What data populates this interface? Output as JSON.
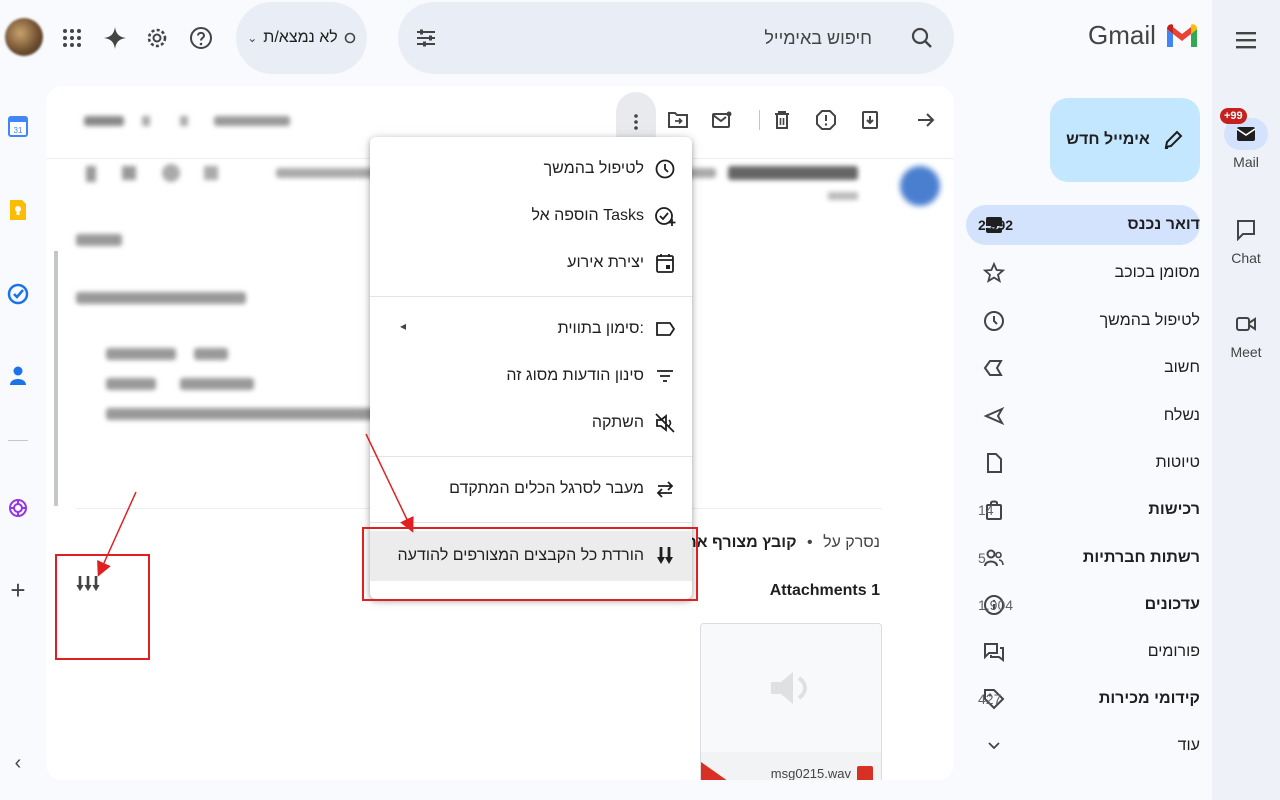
{
  "app": {
    "logo_text": "Gmail"
  },
  "header": {
    "search_placeholder": "חיפוש באימייל",
    "status_label": "לא נמצא/ת"
  },
  "compose_label": "אימייל חדש",
  "nav": [
    {
      "label": "דואר נכנס",
      "count": "2,592"
    },
    {
      "label": "מסומן בכוכב",
      "count": ""
    },
    {
      "label": "לטיפול בהמשך",
      "count": ""
    },
    {
      "label": "חשוב",
      "count": ""
    },
    {
      "label": "נשלח",
      "count": ""
    },
    {
      "label": "טיוטות",
      "count": ""
    },
    {
      "label": "רכישות",
      "count": "14"
    },
    {
      "label": "רשתות חברתיות",
      "count": "5"
    },
    {
      "label": "עדכונים",
      "count": "1,904"
    },
    {
      "label": "פורומים",
      "count": ""
    },
    {
      "label": "קידומי מכירות",
      "count": "427"
    },
    {
      "label": "עוד",
      "count": ""
    }
  ],
  "rail": {
    "mail_label": "Mail",
    "mail_badge": "+99",
    "chat_label": "Chat",
    "meet_label": "Meet"
  },
  "menu": {
    "items": [
      "לטיפול בהמשך",
      "הוספה אל Tasks",
      "יצירת אירוע",
      "סימון בתווית:",
      "סינון הודעות מסוג זה",
      "השתקה",
      "מעבר לסרגל הכלים המתקדם",
      "הורדת כל הקבצים המצורפים להודעה"
    ]
  },
  "message": {
    "attachment_summary": "קובץ מצורף אחד",
    "scan_text": "נסרק על",
    "attachments_heading": "Attachments 1",
    "attachment_file": "msg0215.wav"
  },
  "colors": {
    "accent_blue": "#1a73e8",
    "compose_bg": "#c2e7ff",
    "active_nav": "#d3e3fd",
    "annotation_red": "#e02020"
  }
}
